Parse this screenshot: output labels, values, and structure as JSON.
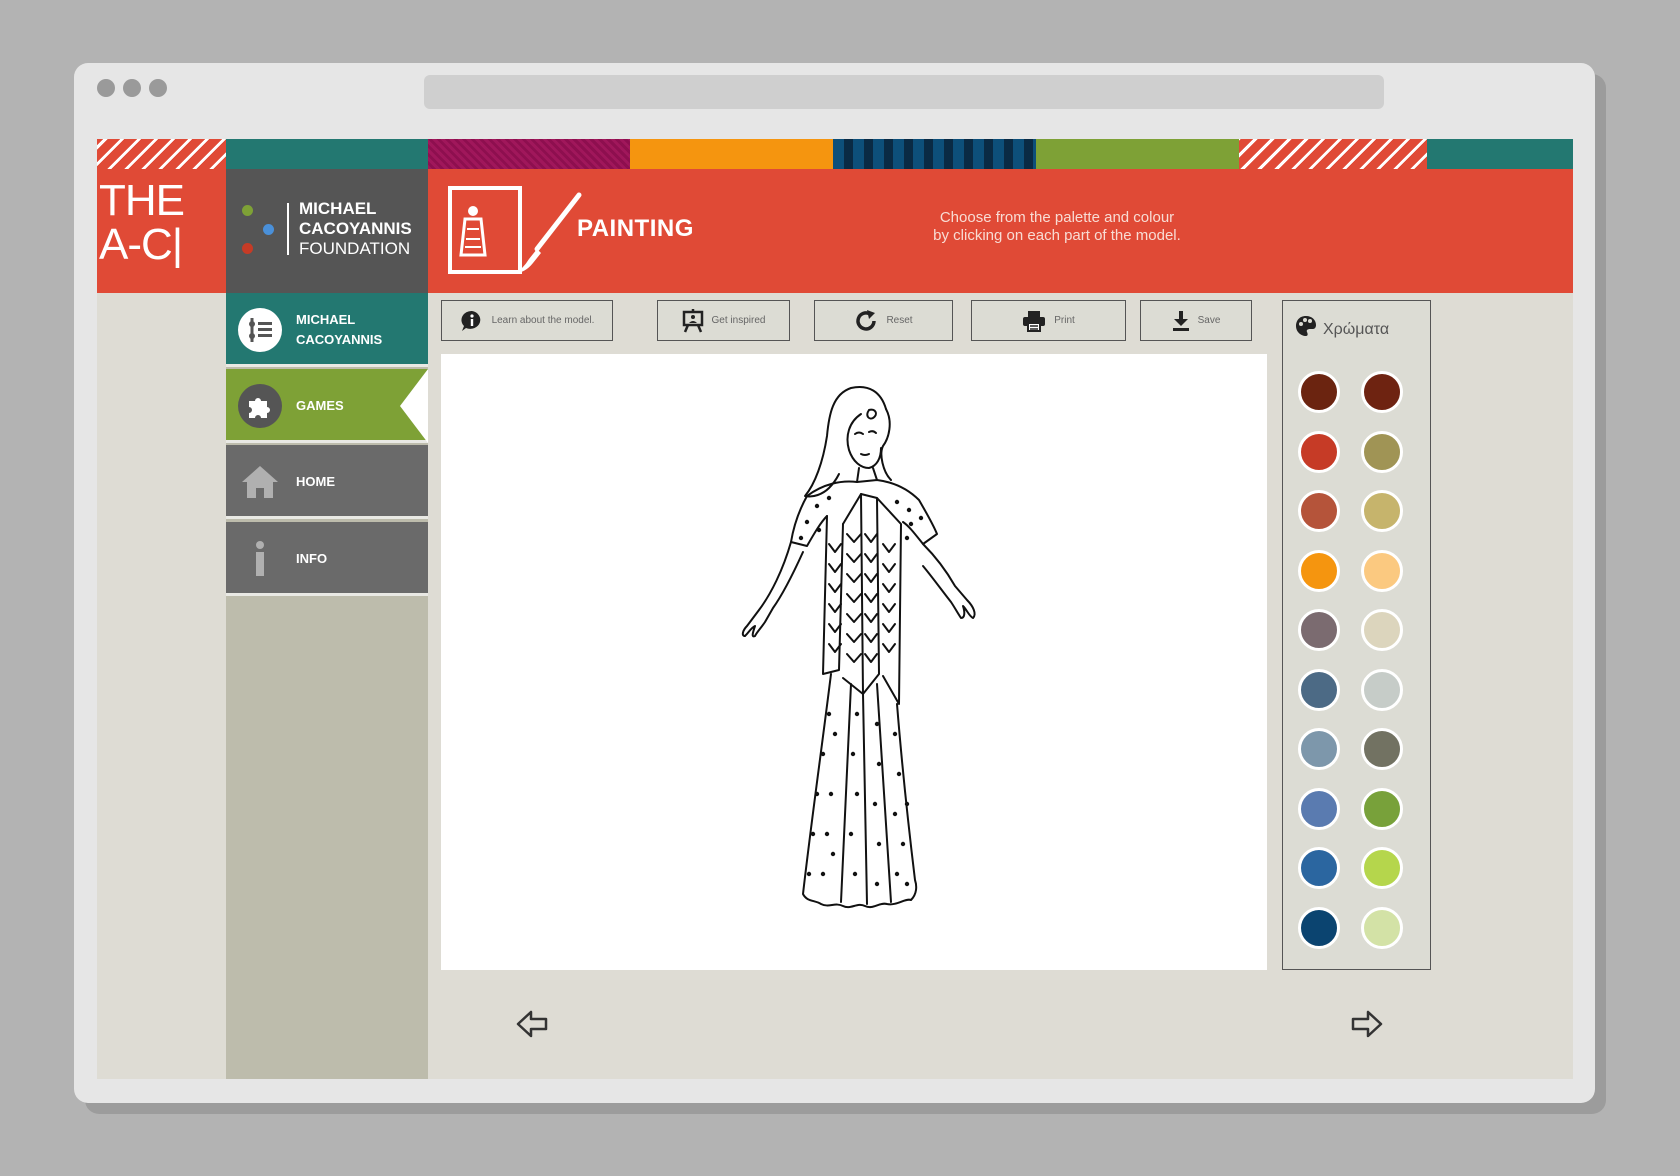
{
  "logo": {
    "line1": "THE",
    "line2": "A-C|"
  },
  "foundation": {
    "line1": "MICHAEL",
    "line2": "CACOYANNIS",
    "line3": "FOUNDATION"
  },
  "header": {
    "title": "PAINTING",
    "instructions_line1": "Choose from the palette and colour",
    "instructions_line2": "by clicking on each part of the model."
  },
  "sidebar": {
    "items": [
      {
        "line1": "MICHAEL",
        "line2": "CACOYANNIS",
        "icon": "list-icon"
      },
      {
        "line1": "GAMES",
        "icon": "puzzle-icon",
        "active": true
      },
      {
        "line1": "HOME",
        "icon": "home-icon"
      },
      {
        "line1": "INFO",
        "icon": "info-icon"
      }
    ]
  },
  "toolbar": {
    "learn": "Learn about the model.",
    "inspired": "Get inspired",
    "reset": "Reset",
    "print": "Print",
    "save": "Save"
  },
  "palette": {
    "title": "Χρώματα",
    "colors": [
      "#6b2410",
      "#6e2311",
      "#c63b26",
      "#a09455",
      "#b5543a",
      "#c6b46c",
      "#f5950f",
      "#fbc980",
      "#7b6b70",
      "#dcd5bd",
      "#4c6a85",
      "#c6ccc8",
      "#7d97ab",
      "#727262",
      "#5a7bb0",
      "#78a13a",
      "#2b66a0",
      "#b5d64c",
      "#0b4470",
      "#d3e2a6"
    ]
  },
  "strip_colors": [
    "#e04a36",
    "#237871",
    "#a0175b",
    "#f5950f",
    "#0d4f7a",
    "#7ea136",
    "#e04a36",
    "#237871"
  ]
}
